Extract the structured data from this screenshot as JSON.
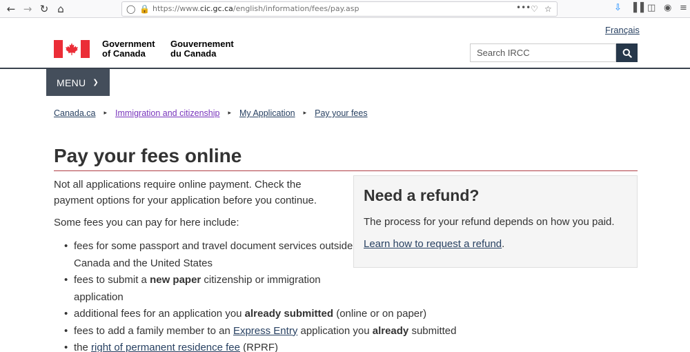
{
  "browser": {
    "url_prefix": "https://www.",
    "url_domain": "cic.gc.ca",
    "url_path": "/english/information/fees/pay.asp",
    "more_glyph": "•••"
  },
  "header": {
    "language_link": "Français",
    "gov_en_line1": "Government",
    "gov_en_line2": "of Canada",
    "gov_fr_line1": "Gouvernement",
    "gov_fr_line2": "du Canada",
    "search_placeholder": "Search IRCC",
    "menu_label": "MENU"
  },
  "breadcrumb": [
    {
      "label": "Canada.ca",
      "visited": false
    },
    {
      "label": "Immigration and citizenship",
      "visited": true
    },
    {
      "label": "My Application",
      "visited": false
    },
    {
      "label": "Pay your fees",
      "visited": false
    }
  ],
  "main": {
    "title": "Pay your fees online",
    "intro": "Not all applications require online payment. Check the payment options for your application before you continue.",
    "fees_intro": "Some fees you can pay for here include:",
    "fees": [
      {
        "before": "fees for some passport and travel document services outside Canada and the United States",
        "bold1": "",
        "middle": "",
        "link": "",
        "after": "",
        "bold2": "",
        "end": ""
      },
      {
        "before": "fees to submit a ",
        "bold1": "new paper",
        "middle": " citizenship or immigration application",
        "link": "",
        "after": "",
        "bold2": "",
        "end": ""
      },
      {
        "before": "additional fees for an application you ",
        "bold1": "already submitted",
        "middle": " (online or on paper)",
        "link": "",
        "after": "",
        "bold2": "",
        "end": ""
      },
      {
        "before": "fees to add a family member to an ",
        "bold1": "",
        "middle": "",
        "link": "Express Entry",
        "after": " application you ",
        "bold2": "already",
        "end": " submitted"
      },
      {
        "before": "the ",
        "bold1": "",
        "middle": "",
        "link": "right of permanent residence fee",
        "after": " (RPRF)",
        "bold2": "",
        "end": ""
      }
    ]
  },
  "refund": {
    "heading": "Need a refund?",
    "text": "The process for your refund depends on how you paid.",
    "link": "Learn how to request a refund",
    "link_suffix": "."
  },
  "colors": {
    "link": "#284162",
    "visited": "#7834bc",
    "flag_red": "#eb2d37",
    "search_button": "#26374a",
    "menu_background": "#444e5b",
    "title_rule": "#af3c43"
  }
}
